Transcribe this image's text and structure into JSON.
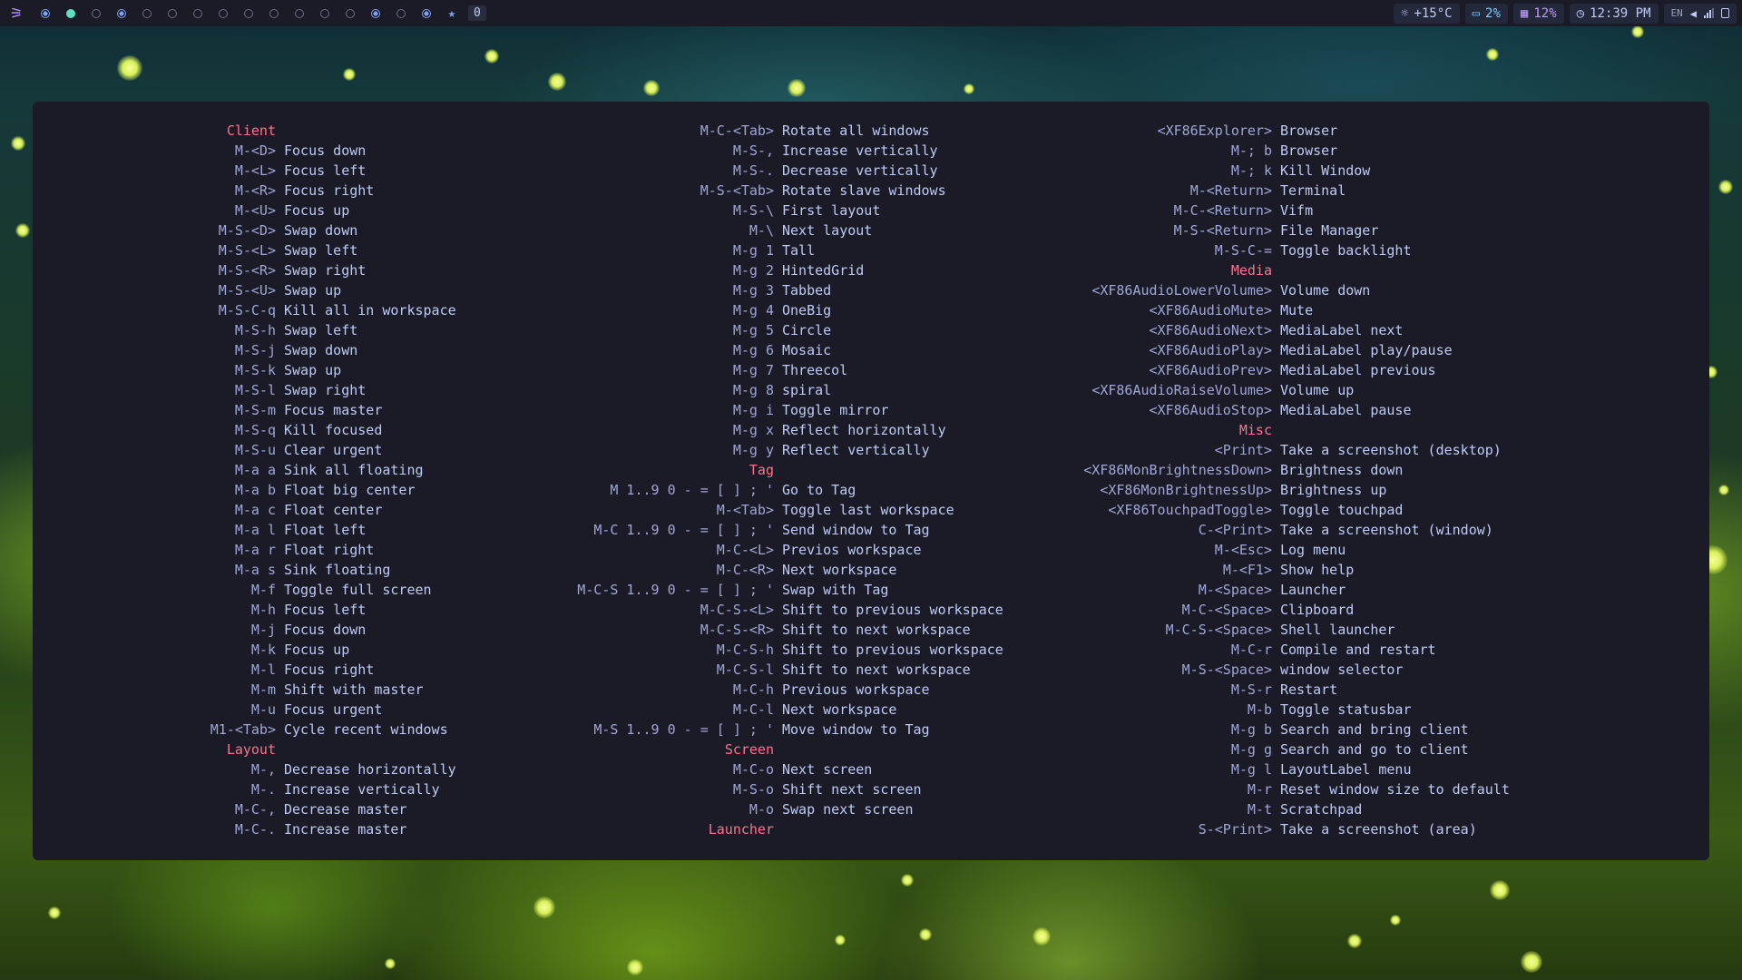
{
  "topbar": {
    "logo_icon": "window-manager-logo-icon",
    "workspaces": [
      "occupied",
      "active",
      "empty",
      "occupied",
      "empty",
      "empty",
      "empty",
      "empty",
      "empty",
      "empty",
      "empty",
      "empty",
      "empty",
      "occupied",
      "empty",
      "occupied"
    ],
    "special_icon": "star-icon",
    "window_count": "0",
    "temperature": "+15°C",
    "cpu": "2%",
    "memory": "12%",
    "time": "12:39 PM",
    "keyboard_layout": "EN"
  },
  "help": {
    "col1": [
      {
        "type": "header",
        "text": "Client"
      },
      {
        "key": "M-<D>",
        "desc": "Focus down"
      },
      {
        "key": "M-<L>",
        "desc": "Focus left"
      },
      {
        "key": "M-<R>",
        "desc": "Focus right"
      },
      {
        "key": "M-<U>",
        "desc": "Focus up"
      },
      {
        "key": "M-S-<D>",
        "desc": "Swap down"
      },
      {
        "key": "M-S-<L>",
        "desc": "Swap left"
      },
      {
        "key": "M-S-<R>",
        "desc": "Swap right"
      },
      {
        "key": "M-S-<U>",
        "desc": "Swap up"
      },
      {
        "key": "M-S-C-q",
        "desc": "Kill all in workspace"
      },
      {
        "key": "M-S-h",
        "desc": "Swap left"
      },
      {
        "key": "M-S-j",
        "desc": "Swap down"
      },
      {
        "key": "M-S-k",
        "desc": "Swap up"
      },
      {
        "key": "M-S-l",
        "desc": "Swap right"
      },
      {
        "key": "M-S-m",
        "desc": "Focus master"
      },
      {
        "key": "M-S-q",
        "desc": "Kill focused"
      },
      {
        "key": "M-S-u",
        "desc": "Clear urgent"
      },
      {
        "key": "M-a a",
        "desc": "Sink all floating"
      },
      {
        "key": "M-a b",
        "desc": "Float big center"
      },
      {
        "key": "M-a c",
        "desc": "Float center"
      },
      {
        "key": "M-a l",
        "desc": "Float left"
      },
      {
        "key": "M-a r",
        "desc": "Float right"
      },
      {
        "key": "M-a s",
        "desc": "Sink floating"
      },
      {
        "key": "M-f",
        "desc": "Toggle full screen"
      },
      {
        "key": "M-h",
        "desc": "Focus left"
      },
      {
        "key": "M-j",
        "desc": "Focus down"
      },
      {
        "key": "M-k",
        "desc": "Focus up"
      },
      {
        "key": "M-l",
        "desc": "Focus right"
      },
      {
        "key": "M-m",
        "desc": "Shift with master"
      },
      {
        "key": "M-u",
        "desc": "Focus urgent"
      },
      {
        "key": "M1-<Tab>",
        "desc": "Cycle recent windows"
      },
      {
        "type": "header",
        "text": "Layout"
      },
      {
        "key": "M-,",
        "desc": "Decrease horizontally"
      },
      {
        "key": "M-.",
        "desc": "Increase vertically"
      },
      {
        "key": "M-C-,",
        "desc": "Decrease master"
      },
      {
        "key": "M-C-.",
        "desc": "Increase master"
      }
    ],
    "col2": [
      {
        "key": "M-C-<Tab>",
        "desc": "Rotate all windows"
      },
      {
        "key": "M-S-,",
        "desc": "Increase vertically"
      },
      {
        "key": "M-S-.",
        "desc": "Decrease vertically"
      },
      {
        "key": "M-S-<Tab>",
        "desc": "Rotate slave windows"
      },
      {
        "key": "M-S-\\",
        "desc": "First layout"
      },
      {
        "key": "M-\\",
        "desc": "Next layout"
      },
      {
        "key": "M-g 1",
        "desc": "Tall"
      },
      {
        "key": "M-g 2",
        "desc": "HintedGrid"
      },
      {
        "key": "M-g 3",
        "desc": "Tabbed"
      },
      {
        "key": "M-g 4",
        "desc": "OneBig"
      },
      {
        "key": "M-g 5",
        "desc": "Circle"
      },
      {
        "key": "M-g 6",
        "desc": "Mosaic"
      },
      {
        "key": "M-g 7",
        "desc": "Threecol"
      },
      {
        "key": "M-g 8",
        "desc": "spiral"
      },
      {
        "key": "M-g i",
        "desc": "Toggle mirror"
      },
      {
        "key": "M-g x",
        "desc": "Reflect horizontally"
      },
      {
        "key": "M-g y",
        "desc": "Reflect vertically"
      },
      {
        "type": "header",
        "text": "Tag"
      },
      {
        "key": "M 1..9 0 - = [ ] ; '",
        "desc": "Go to Tag"
      },
      {
        "key": "M-<Tab>",
        "desc": "Toggle last workspace"
      },
      {
        "key": "M-C 1..9 0 - = [ ] ; '",
        "desc": "Send window to Tag"
      },
      {
        "key": "M-C-<L>",
        "desc": "Previos workspace"
      },
      {
        "key": "M-C-<R>",
        "desc": "Next workspace"
      },
      {
        "key": "M-C-S 1..9 0 - = [ ] ; '",
        "desc": "Swap with Tag"
      },
      {
        "key": "M-C-S-<L>",
        "desc": "Shift to previous workspace"
      },
      {
        "key": "M-C-S-<R>",
        "desc": "Shift to next workspace"
      },
      {
        "key": "M-C-S-h",
        "desc": "Shift to previous workspace"
      },
      {
        "key": "M-C-S-l",
        "desc": "Shift to next workspace"
      },
      {
        "key": "M-C-h",
        "desc": "Previous workspace"
      },
      {
        "key": "M-C-l",
        "desc": "Next workspace"
      },
      {
        "key": "M-S 1..9 0 - = [ ] ; '",
        "desc": "Move window to Tag"
      },
      {
        "type": "header",
        "text": "Screen"
      },
      {
        "key": "M-C-o",
        "desc": "Next screen"
      },
      {
        "key": "M-S-o",
        "desc": "Shift next screen"
      },
      {
        "key": "M-o",
        "desc": "Swap next screen"
      },
      {
        "type": "header",
        "text": "Launcher"
      }
    ],
    "col3": [
      {
        "key": "<XF86Explorer>",
        "desc": "Browser"
      },
      {
        "key": "M-; b",
        "desc": "Browser"
      },
      {
        "key": "M-; k",
        "desc": "Kill Window"
      },
      {
        "key": "M-<Return>",
        "desc": "Terminal"
      },
      {
        "key": "M-C-<Return>",
        "desc": "Vifm"
      },
      {
        "key": "M-S-<Return>",
        "desc": "File Manager"
      },
      {
        "key": "M-S-C-=",
        "desc": "Toggle backlight"
      },
      {
        "type": "header",
        "text": "Media"
      },
      {
        "key": "<XF86AudioLowerVolume>",
        "desc": "Volume down"
      },
      {
        "key": "<XF86AudioMute>",
        "desc": "Mute"
      },
      {
        "key": "<XF86AudioNext>",
        "desc": "MediaLabel next"
      },
      {
        "key": "<XF86AudioPlay>",
        "desc": "MediaLabel play/pause"
      },
      {
        "key": "<XF86AudioPrev>",
        "desc": "MediaLabel previous"
      },
      {
        "key": "<XF86AudioRaiseVolume>",
        "desc": "Volume up"
      },
      {
        "key": "<XF86AudioStop>",
        "desc": "MediaLabel pause"
      },
      {
        "type": "header",
        "text": "Misc"
      },
      {
        "key": "<Print>",
        "desc": "Take a screenshot (desktop)"
      },
      {
        "key": "<XF86MonBrightnessDown>",
        "desc": "Brightness down"
      },
      {
        "key": "<XF86MonBrightnessUp>",
        "desc": "Brightness up"
      },
      {
        "key": "<XF86TouchpadToggle>",
        "desc": "Toggle touchpad"
      },
      {
        "key": "C-<Print>",
        "desc": "Take a screenshot (window)"
      },
      {
        "key": "M-<Esc>",
        "desc": "Log menu"
      },
      {
        "key": "M-<F1>",
        "desc": "Show help"
      },
      {
        "key": "M-<Space>",
        "desc": "Launcher"
      },
      {
        "key": "M-C-<Space>",
        "desc": "Clipboard"
      },
      {
        "key": "M-C-S-<Space>",
        "desc": "Shell launcher"
      },
      {
        "key": "M-C-r",
        "desc": "Compile and restart"
      },
      {
        "key": "M-S-<Space>",
        "desc": "window selector"
      },
      {
        "key": "M-S-r",
        "desc": "Restart"
      },
      {
        "key": "M-b",
        "desc": "Toggle statusbar"
      },
      {
        "key": "M-g b",
        "desc": "Search and bring client"
      },
      {
        "key": "M-g g",
        "desc": "Search and go to client"
      },
      {
        "key": "M-g l",
        "desc": "LayoutLabel menu"
      },
      {
        "key": "M-r",
        "desc": "Reset window size to default"
      },
      {
        "key": "M-t",
        "desc": "Scratchpad"
      },
      {
        "key": "S-<Print>",
        "desc": "Take a screenshot (area)"
      }
    ]
  }
}
